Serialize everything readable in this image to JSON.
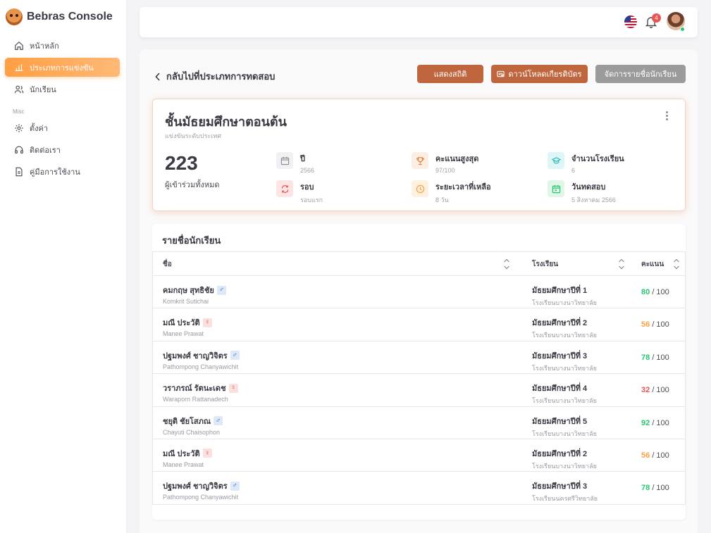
{
  "brand": {
    "title": "Bebras Console"
  },
  "sidebar": {
    "items": [
      {
        "label": "หน้าหลัก",
        "icon": "home-icon"
      },
      {
        "label": "ประเภทการแข่งขัน",
        "icon": "competition-icon",
        "active": true
      },
      {
        "label": "นักเรียน",
        "icon": "users-icon"
      }
    ],
    "section_label": "Misc",
    "misc_items": [
      {
        "label": "ตั้งค่า",
        "icon": "gear-icon"
      },
      {
        "label": "ติดต่อเรา",
        "icon": "headset-icon"
      },
      {
        "label": "คู่มือการใช้งาน",
        "icon": "document-icon"
      }
    ]
  },
  "topbar": {
    "notification_count": "4",
    "language_flag": "us-flag-icon"
  },
  "page": {
    "back_label": "กลับไปที่ประเภทการทดสอบ",
    "buttons": {
      "stats": "แสดงสถิติ",
      "certificate": "ดาวน์โหลดเกียรติบัตร",
      "manage": "จัดการรายชื่อนักเรียน"
    }
  },
  "info": {
    "title": "ชั้นมัธยมศึกษาตอนต้น",
    "subtitle": "แข่งขันระดับประเทศ",
    "total_participants": "223",
    "total_label": "ผู้เข้าร่วมทั้งหมด",
    "stats": [
      {
        "label": "ปี",
        "value": "2566"
      },
      {
        "label": "คะแนนสูงสุด",
        "value": "97/100"
      },
      {
        "label": "จำนวนโรงเรียน",
        "value": "6"
      },
      {
        "label": "รอบ",
        "value": "รอบแรก"
      },
      {
        "label": "ระยะเวลาที่เหลือ",
        "value": "8 วัน"
      },
      {
        "label": "วันทดสอบ",
        "value": "5 สิงหาคม 2566"
      }
    ]
  },
  "students": {
    "title": "รายชื่อนักเรียน",
    "columns": {
      "name": "ชื่อ",
      "school": "โรงเรียน",
      "score": "คะแนน"
    },
    "max_score": "/ 100",
    "rows": [
      {
        "name_th": "คมกฤษ สุทธิชัย",
        "name_en": "Komkrit Sutichai",
        "gender": "m",
        "grade": "มัธยมศึกษาปีที่ 1",
        "school": "โรงเรียนบางนาวิทยาลัย",
        "score": "80",
        "score_color": "#28c76f"
      },
      {
        "name_th": "มณี ประวัติ",
        "name_en": "Manee Prawat",
        "gender": "f",
        "grade": "มัธยมศึกษาปีที่ 2",
        "school": "โรงเรียนบางนาวิทยาลัย",
        "score": "56",
        "score_color": "#ff9f43"
      },
      {
        "name_th": "ปฐมพงศ์ ชาญวิจิตร",
        "name_en": "Pathompong Chanyawichit",
        "gender": "m",
        "grade": "มัธยมศึกษาปีที่ 3",
        "school": "โรงเรียนบางนาวิทยาลัย",
        "score": "78",
        "score_color": "#28c76f"
      },
      {
        "name_th": "วราภรณ์ รัตนะเดช",
        "name_en": "Waraporn Rattanadech",
        "gender": "f",
        "grade": "มัธยมศึกษาปีที่ 4",
        "school": "โรงเรียนบางนาวิทยาลัย",
        "score": "32",
        "score_color": "#ea5455"
      },
      {
        "name_th": "ชยุติ ชัยโสภณ",
        "name_en": "Chayuti Chaisophon",
        "gender": "m",
        "grade": "มัธยมศึกษาปีที่ 5",
        "school": "โรงเรียนบางนาวิทยาลัย",
        "score": "92",
        "score_color": "#28c76f"
      },
      {
        "name_th": "มณี ประวัติ",
        "name_en": "Manee Prawat",
        "gender": "f",
        "grade": "มัธยมศึกษาปีที่ 2",
        "school": "โรงเรียนบางนาวิทยาลัย",
        "score": "56",
        "score_color": "#ff9f43"
      },
      {
        "name_th": "ปฐมพงศ์ ชาญวิจิตร",
        "name_en": "Pathompong Chanyawichit",
        "gender": "m",
        "grade": "มัธยมศึกษาปีที่ 3",
        "school": "โรงเรียนนครศรีวิทยาลัย",
        "score": "78",
        "score_color": "#28c76f"
      }
    ]
  }
}
